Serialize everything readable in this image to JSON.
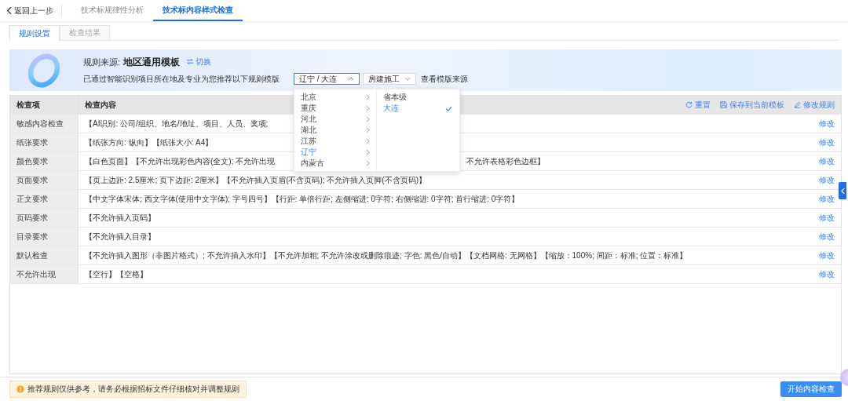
{
  "top_nav": {
    "back": "返回上一步",
    "tabs": [
      {
        "label": "技术标规律性分析",
        "selected": false
      },
      {
        "label": "技术标内容样式检查",
        "selected": true
      }
    ]
  },
  "sub_tabs": [
    {
      "label": "规则设置",
      "selected": true
    },
    {
      "label": "检查结果",
      "selected": false
    }
  ],
  "banner": {
    "source_label": "规则来源:",
    "source_value": "地区通用模板",
    "switch": "切换",
    "hint": "已通过智能识别项目所在地及专业为您推荐以下规则模版",
    "region_select": {
      "value": "辽宁 / 大连",
      "expanded": true
    },
    "type_select": {
      "value": "房建施工"
    },
    "source_link": "查看模版来源"
  },
  "region_dropdown": {
    "provinces": [
      {
        "label": "北京",
        "selected": false
      },
      {
        "label": "重庆",
        "selected": false
      },
      {
        "label": "河北",
        "selected": false
      },
      {
        "label": "湖北",
        "selected": false
      },
      {
        "label": "江苏",
        "selected": false
      },
      {
        "label": "辽宁",
        "selected": true
      },
      {
        "label": "内蒙古",
        "selected": false
      }
    ],
    "cities": [
      {
        "label": "省本级",
        "selected": false
      },
      {
        "label": "大连",
        "selected": true
      }
    ]
  },
  "table": {
    "columns": [
      "检查项",
      "检查内容"
    ],
    "actions": [
      "重置",
      "保存到当前模板",
      "修改规则"
    ],
    "rows": [
      {
        "item": "敏感内容检查",
        "segments": [
          "【AI识别: 公司/组织、地名/地址、项目、人员、奖项;"
        ],
        "action": "修改"
      },
      {
        "item": "纸张要求",
        "segments": [
          "【纸张方向: 纵向】【纸张大小: A4】"
        ],
        "action": "修改"
      },
      {
        "item": "颜色要求",
        "segments": [
          "【白色页面】【不允许出现彩色内容(全文); 不允许出现",
          "不允许表格彩色边框】"
        ],
        "action": "修改"
      },
      {
        "item": "页面要求",
        "segments": [
          "【页上边距: 2.5厘米; 页下边距: 2厘米】【不允许插入页眉(不含页码); 不允许插入页脚(不含页码)】"
        ],
        "action": "修改"
      },
      {
        "item": "正文要求",
        "segments": [
          "【中文字体宋体; 西文字体(使用中文字体); 字号四号】【行距: 单倍行距; 左侧缩进: 0字符; 右侧缩进: 0字符; 首行缩进: 0字符】"
        ],
        "action": "修改"
      },
      {
        "item": "页码要求",
        "segments": [
          "【不允许插入页码】"
        ],
        "action": "修改"
      },
      {
        "item": "目录要求",
        "segments": [
          "【不允许插入目录】"
        ],
        "action": "修改"
      },
      {
        "item": "默认检查",
        "segments": [
          "【不允许插入图形（非图片格式）; 不允许插入水印】【不允许加粗; 不允许涂改或删除痕迹; 字色: 黑色/自动】【文档网格: 无网格】【缩放：100%; 间距：标准; 位置：标准】"
        ],
        "action": "修改"
      },
      {
        "item": "不允许出现",
        "segments": [
          "【空行】【空格】"
        ],
        "action": "修改"
      }
    ]
  },
  "footer": {
    "notice": "推荐规则仅供参考，请务必根据招标文件仔细核对并调整规则",
    "start_button": "开始内容检查"
  }
}
